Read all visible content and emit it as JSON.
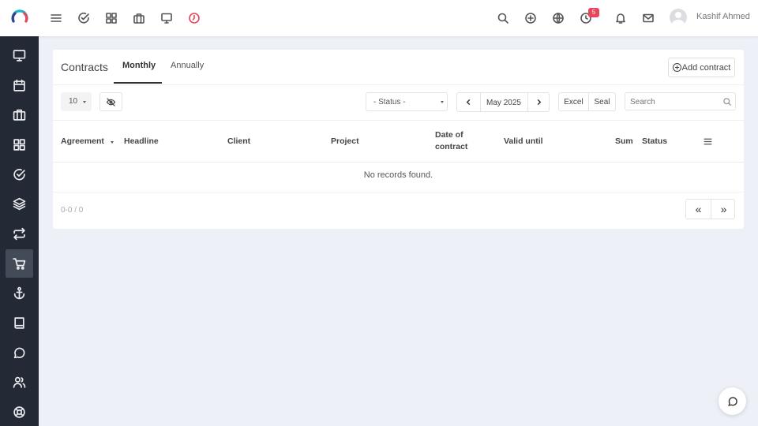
{
  "user": {
    "name": "Kashif Ahmed"
  },
  "notifications": {
    "timer_badge": "5"
  },
  "topbar_icons": [
    "menu-icon",
    "check-circle-icon",
    "grid-icon",
    "briefcase-icon",
    "monitor-icon",
    "clock-icon",
    "search-icon",
    "plus-circle-icon",
    "globe-icon",
    "history-icon",
    "bell-icon",
    "mail-icon"
  ],
  "sidebar_icons": [
    "monitor-icon",
    "calendar-icon",
    "briefcase-icon",
    "grid-icon",
    "check-circle-icon",
    "layers-icon",
    "repeat-icon",
    "cart-icon",
    "anchor-icon",
    "book-icon",
    "message-circle-icon",
    "users-icon",
    "lifebuoy-icon"
  ],
  "sidebar_active": "cart-icon",
  "page": {
    "title": "Contracts",
    "tabs": [
      {
        "label": "Monthly",
        "active": true
      },
      {
        "label": "Annually",
        "active": false
      }
    ],
    "add_button": "Add contract"
  },
  "toolbar": {
    "page_size": "10",
    "status_placeholder": "- Status -",
    "period": "May 2025",
    "excel_label": "Excel",
    "seal_label": "Seal",
    "search_placeholder": "Search"
  },
  "table": {
    "columns": [
      "Agreement",
      "Headline",
      "Client",
      "Project",
      "Date of contract",
      "Valid until",
      "Sum",
      "Status"
    ],
    "date_col_line1": "Date of",
    "date_col_line2": "contract",
    "empty_message": "No records found.",
    "pager_info": "0-0 / 0",
    "first_label": "«",
    "last_label": "»"
  },
  "colors": {
    "sidebar_bg": "#232935",
    "accent": "#e8465a",
    "page_bg": "#eef0f8"
  }
}
